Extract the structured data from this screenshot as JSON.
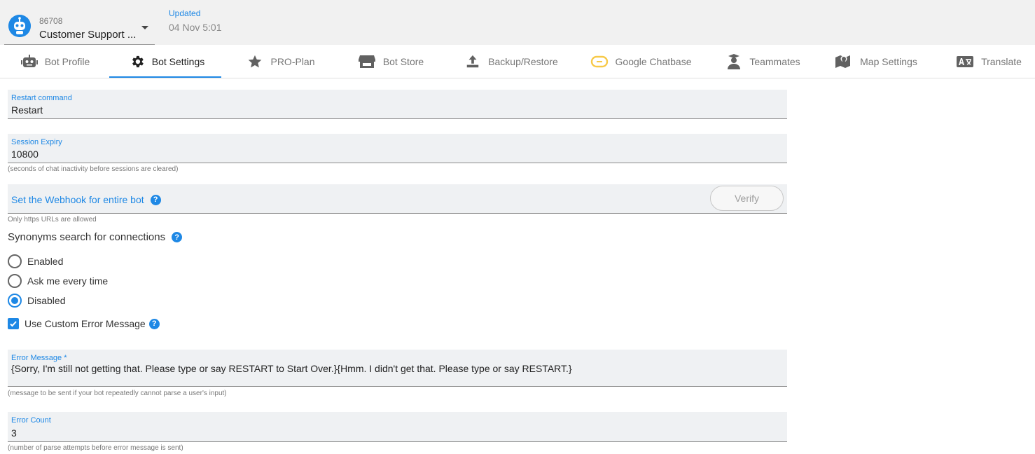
{
  "header": {
    "bot_id": "86708",
    "bot_name": "Customer Support ...",
    "updated_label": "Updated",
    "updated_value": "04 Nov 5:01"
  },
  "tabs": [
    {
      "label": "Bot Profile",
      "icon": "robot-icon"
    },
    {
      "label": "Bot Settings",
      "icon": "gear-icon",
      "active": true
    },
    {
      "label": "PRO-Plan",
      "icon": "star-icon"
    },
    {
      "label": "Bot Store",
      "icon": "store-icon"
    },
    {
      "label": "Backup/Restore",
      "icon": "upload-icon"
    },
    {
      "label": "Google Chatbase",
      "icon": "chatbase-icon"
    },
    {
      "label": "Teammates",
      "icon": "teammates-icon"
    },
    {
      "label": "Map Settings",
      "icon": "map-icon"
    },
    {
      "label": "Translate",
      "icon": "translate-icon"
    }
  ],
  "colors": {
    "accent": "#1e88e5",
    "field_bg": "#eff1f3",
    "chatbase": "#f7c948"
  },
  "restart": {
    "label": "Restart command",
    "value": "Restart"
  },
  "session": {
    "label": "Session Expiry",
    "value": "10800",
    "hint": "(seconds of chat inactivity before sessions are cleared)"
  },
  "webhook": {
    "label": "Set the Webhook for entire bot",
    "verify_label": "Verify",
    "hint": "Only https URLs are allowed"
  },
  "synonyms": {
    "title": "Synonyms search for connections",
    "options": [
      "Enabled",
      "Ask me every time",
      "Disabled"
    ],
    "selected": "Disabled"
  },
  "custom_error": {
    "label": "Use Custom Error Message",
    "checked": true
  },
  "error_message": {
    "label": "Error Message *",
    "value": "{Sorry, I'm still not getting that. Please type or say RESTART to Start Over.}{Hmm. I didn't get that. Please type or say RESTART.}",
    "hint": "(message to be sent if your bot repeatedly cannot parse a user's input)"
  },
  "error_count": {
    "label": "Error Count",
    "value": "3",
    "hint": "(number of parse attempts before error message is sent)"
  },
  "help_glyph": "?"
}
